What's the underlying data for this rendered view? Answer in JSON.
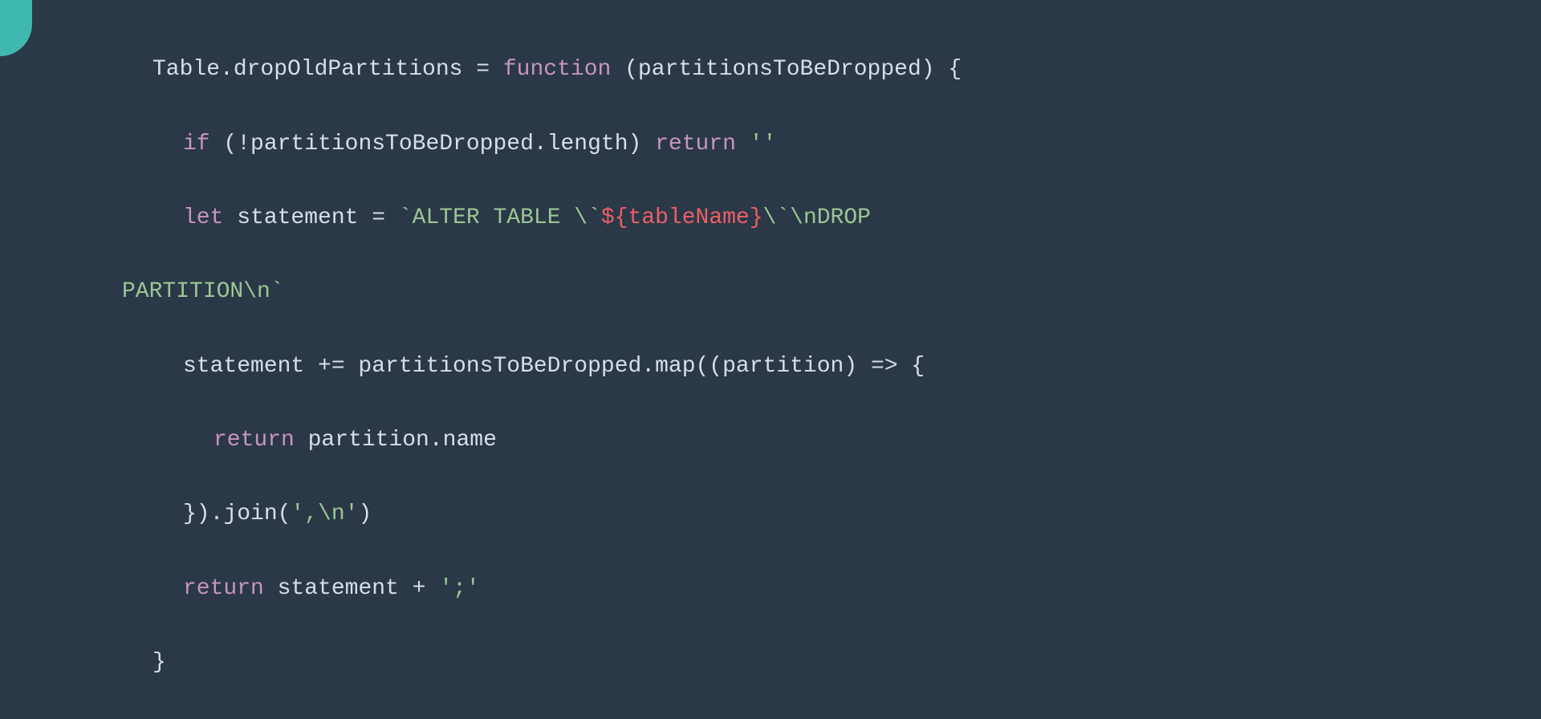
{
  "code": {
    "line1": {
      "t1": "Table.dropOldPartitions = ",
      "t2": "function",
      "t3": " (partitionsToBeDropped) {"
    },
    "line2": {
      "t1": "if",
      "t2": " (!partitionsToBeDropped.length) ",
      "t3": "return",
      "t4": " ",
      "t5": "''"
    },
    "line3": {
      "t1": "let",
      "t2": " statement = ",
      "t3": "`ALTER TABLE \\`",
      "t4": "${tableName}",
      "t5": "\\`\\nDROP "
    },
    "line4": {
      "t1": "PARTITION\\n`"
    },
    "line5": {
      "t1": "statement += partitionsToBeDropped.map((partition) => {"
    },
    "line6": {
      "t1": "return",
      "t2": " partition.name"
    },
    "line7": {
      "t1": "}).join(",
      "t2": "',\\n'",
      "t3": ")"
    },
    "line8": {
      "t1": "return",
      "t2": " statement + ",
      "t3": "';'"
    },
    "line9": {
      "t1": "}"
    }
  }
}
